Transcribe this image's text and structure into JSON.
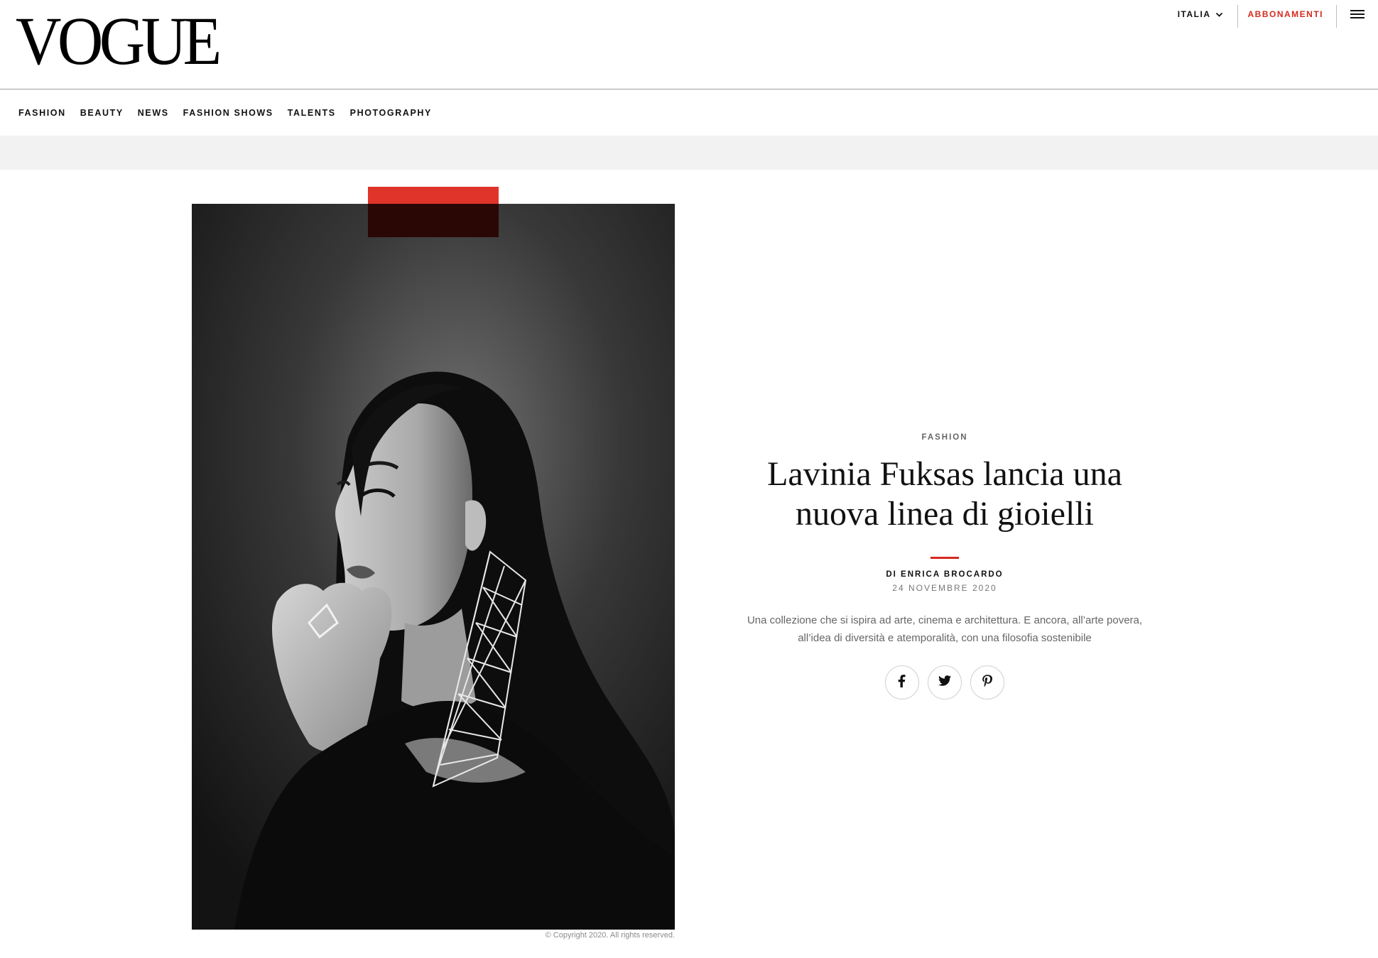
{
  "header": {
    "logo": "VOGUE",
    "country": "ITALIA",
    "subscribe": "ABBONAMENTI",
    "menu_icon": "hamburger-menu-icon",
    "accent_color": "#d52b1e"
  },
  "nav": {
    "items": [
      {
        "label": "FASHION"
      },
      {
        "label": "BEAUTY"
      },
      {
        "label": "NEWS"
      },
      {
        "label": "FASHION SHOWS"
      },
      {
        "label": "TALENTS"
      },
      {
        "label": "PHOTOGRAPHY"
      }
    ]
  },
  "hero": {
    "image": "black-and-white-portrait-woman-with-geometric-earring",
    "copyright": "© Copyright 2020. All rights reserved."
  },
  "article": {
    "category": "FASHION",
    "title": "Lavinia Fuksas lancia una nuova linea di gioielli",
    "byline": "DI ENRICA BROCARDO",
    "date": "24 NOVEMBRE 2020",
    "dek": "Una collezione che si ispira ad arte, cinema e architettura. E ancora, all’arte povera, all’idea di diversità e atemporalità, con una filosofia sostenibile",
    "share": [
      {
        "network": "facebook",
        "icon": "facebook-icon"
      },
      {
        "network": "twitter",
        "icon": "twitter-icon"
      },
      {
        "network": "pinterest",
        "icon": "pinterest-icon"
      }
    ]
  }
}
